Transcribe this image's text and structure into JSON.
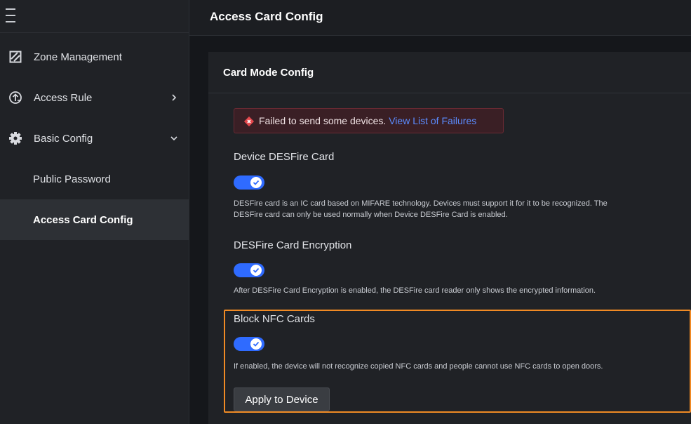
{
  "sidebar": {
    "menu_icon": "hamburger-menu-icon",
    "items": [
      {
        "label": "Zone Management",
        "icon": "zone-slash-square-icon"
      },
      {
        "label": "Access Rule",
        "icon": "access-rule-icon",
        "arrow": "chevron-right-icon"
      },
      {
        "label": "Basic Config",
        "icon": "gear-icon",
        "arrow": "chevron-down-icon"
      },
      {
        "label": "Public Password"
      },
      {
        "label": "Access Card Config",
        "active": true
      }
    ]
  },
  "header": {
    "title": "Access Card Config"
  },
  "panel": {
    "title": "Card Mode Config",
    "alert": {
      "icon": "error-diamond-icon",
      "message": "Failed to send some devices.",
      "link": "View List of Failures"
    },
    "settings": [
      {
        "title": "Device DESFire Card",
        "enabled": true,
        "desc_line1": "DESFire card is an IC card based on MIFARE technology. Devices must support it for it to be recognized. The",
        "desc_line2": "DESFire card can only be used normally when Device DESFire Card is enabled."
      },
      {
        "title": "DESFire Card Encryption",
        "enabled": true,
        "desc_line1": "After DESFire Card Encryption is enabled, the DESFire card reader only shows the encrypted information."
      },
      {
        "title": "Block NFC Cards",
        "enabled": true,
        "desc_line1": "If enabled, the device will not recognize copied NFC cards and people cannot use NFC cards to open doors."
      }
    ],
    "apply_button": "Apply to Device"
  },
  "colors": {
    "accent": "#2f6bff",
    "link": "#5b8cff",
    "highlight": "#f08a24",
    "error": "#e5484d"
  }
}
